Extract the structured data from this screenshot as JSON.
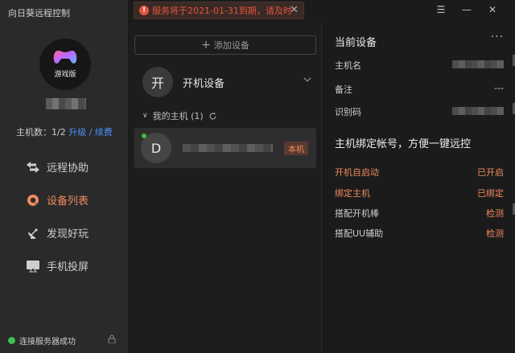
{
  "app": {
    "title": "向日葵远程控制"
  },
  "notice": {
    "text": "服务将于2021-01-31到期，请及时"
  },
  "window": {
    "menu": "☰",
    "minimize": "—",
    "close": "✕"
  },
  "sidebar": {
    "avatar_label": "游戏版",
    "host_count_label": "主机数：1/2",
    "upgrade": "升级",
    "renew": "续费",
    "nav": [
      {
        "label": "远程协助"
      },
      {
        "label": "设备列表"
      },
      {
        "label": "发现好玩"
      },
      {
        "label": "手机投屏"
      }
    ],
    "status": "连接服务器成功"
  },
  "device_list": {
    "add_button": "添加设备",
    "group_avatar": "开",
    "group_title": "开机设备",
    "my_hosts": "我的主机 (1)",
    "devices": [
      {
        "avatar": "D",
        "badge": "本机"
      }
    ]
  },
  "current_device": {
    "title": "当前设备",
    "more": "···",
    "fields": [
      {
        "key": "主机名"
      },
      {
        "key": "备注",
        "value": "---"
      },
      {
        "key": "识别码"
      }
    ],
    "section_title": "主机绑定帐号，方便一键远控",
    "options": [
      {
        "key": "开机自启动",
        "value": "已开启"
      },
      {
        "key": "绑定主机",
        "value": "已绑定"
      },
      {
        "key": "搭配开机棒",
        "value": "检测"
      },
      {
        "key": "搭配UU辅助",
        "value": "检测"
      }
    ]
  },
  "colors": {
    "accent": "#f08a5d",
    "link": "#4e8ef7",
    "online": "#3cc14e",
    "alert": "#e5533d"
  }
}
